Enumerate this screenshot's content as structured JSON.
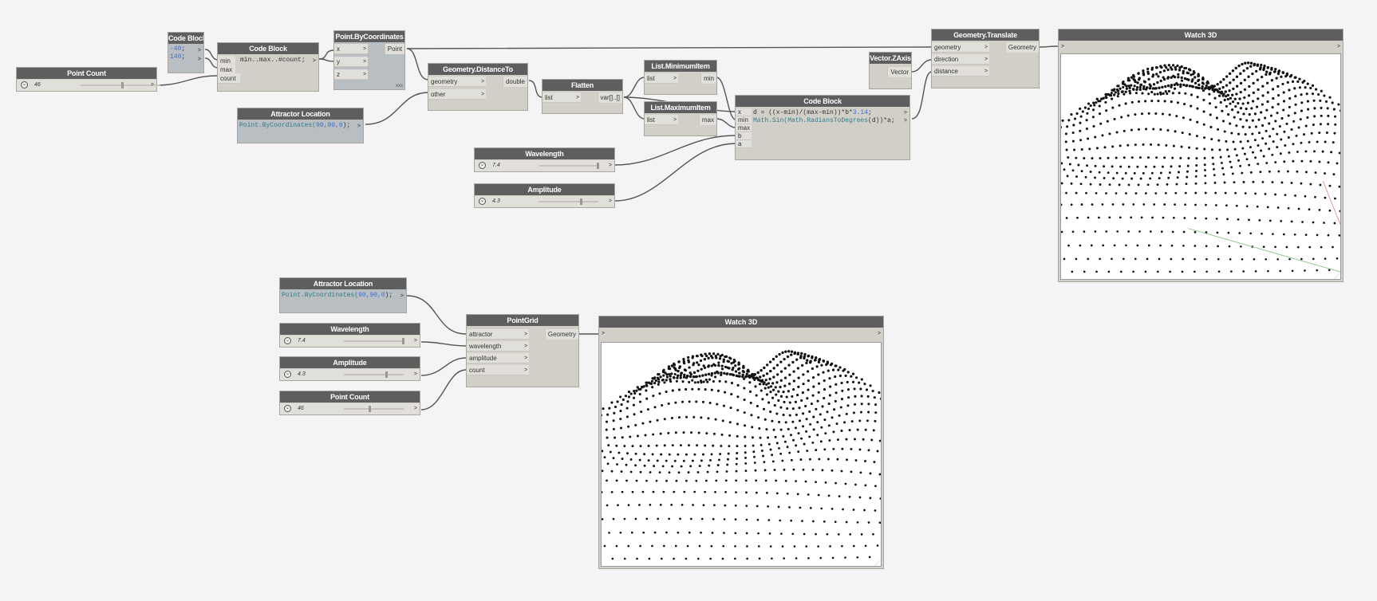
{
  "colors": {
    "canvas": "#f4f4f4",
    "header": "#5e5e5e",
    "node_body": "#d2cfc8",
    "code_body": "#b8bec2",
    "wire": "#555555"
  },
  "top": {
    "point_count": {
      "title": "Point Count",
      "value": "46",
      "level": 0.46
    },
    "code_block_a": {
      "title": "Code Block",
      "line1_num": "-40",
      "line1_rest": ";",
      "line2_num": "140",
      "line2_rest": ";"
    },
    "code_block_b": {
      "title": "Code Block",
      "ports": [
        "min",
        "max",
        "count"
      ],
      "code": "min..max..#count;"
    },
    "point_by_coords": {
      "title": "Point.ByCoordinates",
      "ports": [
        "x",
        "y",
        "z"
      ],
      "out": "Point",
      "lacing": "xxx"
    },
    "attractor": {
      "title": "Attractor Location",
      "code_fn": "Point.ByCoordinates(",
      "code_nums": "90,90,0",
      "code_end": ");"
    },
    "distance_to": {
      "title": "Geometry.DistanceTo",
      "ports": [
        "geometry",
        "other"
      ],
      "out": "double"
    },
    "flatten": {
      "title": "Flatten",
      "ports": [
        "list"
      ],
      "out": "var[]..[]"
    },
    "list_min": {
      "title": "List.MinimumItem",
      "ports": [
        "list"
      ],
      "out": "min"
    },
    "list_max": {
      "title": "List.MaximumItem",
      "ports": [
        "list"
      ],
      "out": "max"
    },
    "wavelength": {
      "title": "Wavelength",
      "value": "7.4",
      "level": 0.95
    },
    "amplitude": {
      "title": "Amplitude",
      "value": "4.3",
      "level": 0.6
    },
    "code_block_c": {
      "title": "Code Block",
      "ports": [
        "x",
        "min",
        "max",
        "b",
        "a"
      ],
      "line1_a": "d = ((x-min)/(max-min))*b*",
      "line1_num": "3.14",
      "line1_end": ";",
      "line2_fn1": "Math.Sin(",
      "line2_fn2": "Math.RadiansToDegrees",
      "line2_end": "(d))*a;"
    },
    "vector_z": {
      "title": "Vector.ZAxis",
      "out": "Vector"
    },
    "translate": {
      "title": "Geometry.Translate",
      "ports": [
        "geometry",
        "direction",
        "distance"
      ],
      "out": "Geometry"
    },
    "watch3d": {
      "title": "Watch 3D"
    }
  },
  "bottom": {
    "attractor": {
      "title": "Attractor Location",
      "code_fn": "Point.ByCoordinates(",
      "code_nums": "90,90,0",
      "code_end": ");"
    },
    "wavelength": {
      "title": "Wavelength",
      "value": "7.4",
      "level": 0.95
    },
    "amplitude": {
      "title": "Amplitude",
      "value": "4.3",
      "level": 0.6
    },
    "point_count": {
      "title": "Point Count",
      "value": "46",
      "level": 0.46
    },
    "pointgrid": {
      "title": "PointGrid",
      "ports": [
        "attractor",
        "wavelength",
        "amplitude",
        "count"
      ],
      "out": "Geometry"
    },
    "watch3d": {
      "title": "Watch 3D"
    }
  },
  "glyphs": {
    "chevron": ">",
    "dropdown": "⌄",
    "resize": "⋰"
  }
}
